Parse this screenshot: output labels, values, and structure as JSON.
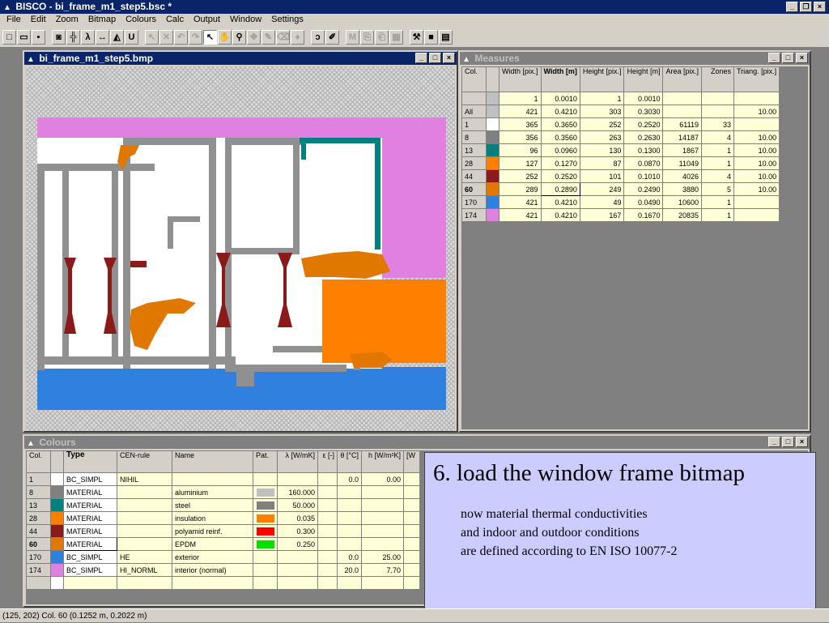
{
  "app": {
    "title": "BISCO - bi_frame_m1_step5.bsc *"
  },
  "menu": [
    "File",
    "Edit",
    "Zoom",
    "Bitmap",
    "Colours",
    "Calc",
    "Output",
    "Window",
    "Settings"
  ],
  "toolbar": {
    "zoom_label": "λ",
    "u_label": "U",
    "m_label": "M"
  },
  "bitmap_window": {
    "title": "bi_frame_m1_step5.bmp"
  },
  "measures_window": {
    "title": "Measures",
    "headers": [
      "Col.",
      "",
      "Width [pix.]",
      "Width [m]",
      "Height [pix.]",
      "Height [m]",
      "Area [pix.]",
      "Zones",
      "Triang. [pix.]"
    ],
    "rows": [
      {
        "col": "",
        "color": "#c0c0c0",
        "w_pix": "1",
        "w_m": "0.0010",
        "h_pix": "1",
        "h_m": "0.0010",
        "area": "",
        "zones": "",
        "triang": ""
      },
      {
        "col": "All",
        "color": "#c0c0c0",
        "w_pix": "421",
        "w_m": "0.4210",
        "h_pix": "303",
        "h_m": "0.3030",
        "area": "",
        "zones": "",
        "triang": "10.00"
      },
      {
        "col": "1",
        "color": "#ffffff",
        "w_pix": "365",
        "w_m": "0.3650",
        "h_pix": "252",
        "h_m": "0.2520",
        "area": "61119",
        "zones": "33",
        "triang": ""
      },
      {
        "col": "8",
        "color": "#808080",
        "w_pix": "356",
        "w_m": "0.3560",
        "h_pix": "263",
        "h_m": "0.2630",
        "area": "14187",
        "zones": "4",
        "triang": "10.00"
      },
      {
        "col": "13",
        "color": "#008080",
        "w_pix": "96",
        "w_m": "0.0960",
        "h_pix": "130",
        "h_m": "0.1300",
        "area": "1867",
        "zones": "1",
        "triang": "10.00"
      },
      {
        "col": "28",
        "color": "#ff8000",
        "w_pix": "127",
        "w_m": "0.1270",
        "h_pix": "87",
        "h_m": "0.0870",
        "area": "11049",
        "zones": "1",
        "triang": "10.00"
      },
      {
        "col": "44",
        "color": "#8b1a1a",
        "w_pix": "252",
        "w_m": "0.2520",
        "h_pix": "101",
        "h_m": "0.1010",
        "area": "4026",
        "zones": "4",
        "triang": "10.00"
      },
      {
        "col": "60",
        "color": "#e07800",
        "w_pix": "289",
        "w_m": "0.2890",
        "h_pix": "249",
        "h_m": "0.2490",
        "area": "3880",
        "zones": "5",
        "triang": "10.00"
      },
      {
        "col": "170",
        "color": "#3080e0",
        "w_pix": "421",
        "w_m": "0.4210",
        "h_pix": "49",
        "h_m": "0.0490",
        "area": "10600",
        "zones": "1",
        "triang": ""
      },
      {
        "col": "174",
        "color": "#e080e0",
        "w_pix": "421",
        "w_m": "0.4210",
        "h_pix": "167",
        "h_m": "0.1670",
        "area": "20835",
        "zones": "1",
        "triang": ""
      }
    ]
  },
  "colours_window": {
    "title": "Colours",
    "headers": [
      "Col.",
      "",
      "Type",
      "CEN-rule",
      "Name",
      "Pat.",
      "λ [W/mK]",
      "ε [-]",
      "θ [°C]",
      "h [W/m²K]",
      "[W"
    ],
    "rows": [
      {
        "col": "1",
        "color": "#ffffff",
        "type": "BC_SIMPL",
        "cen": "NIHIL",
        "name": "",
        "pat": "",
        "lambda": "",
        "eps": "",
        "theta": "0.0",
        "h": "0.00"
      },
      {
        "col": "8",
        "color": "#808080",
        "type": "MATERIAL",
        "cen": "",
        "name": "aluminium",
        "pat": "#c0c0c0",
        "lambda": "160.000",
        "eps": "",
        "theta": "",
        "h": ""
      },
      {
        "col": "13",
        "color": "#008080",
        "type": "MATERIAL",
        "cen": "",
        "name": "steel",
        "pat": "#808080",
        "lambda": "50.000",
        "eps": "",
        "theta": "",
        "h": ""
      },
      {
        "col": "28",
        "color": "#ff8000",
        "type": "MATERIAL",
        "cen": "",
        "name": "insulation",
        "pat": "#ff8000",
        "lambda": "0.035",
        "eps": "",
        "theta": "",
        "h": ""
      },
      {
        "col": "44",
        "color": "#8b1a1a",
        "type": "MATERIAL",
        "cen": "",
        "name": "polyamid reinf.",
        "pat": "#ff0000",
        "lambda": "0.300",
        "eps": "",
        "theta": "",
        "h": ""
      },
      {
        "col": "60",
        "color": "#e07800",
        "type": "MATERIAL",
        "cen": "",
        "name": "EPDM",
        "pat": "#00e000",
        "lambda": "0.250",
        "eps": "",
        "theta": "",
        "h": ""
      },
      {
        "col": "170",
        "color": "#3080e0",
        "type": "BC_SIMPL",
        "cen": "HE",
        "name": "exterior",
        "pat": "",
        "lambda": "",
        "eps": "",
        "theta": "0.0",
        "h": "25.00"
      },
      {
        "col": "174",
        "color": "#e080e0",
        "type": "BC_SIMPL",
        "cen": "HI_NORML",
        "name": "interior (normal)",
        "pat": "",
        "lambda": "",
        "eps": "",
        "theta": "20.0",
        "h": "7.70"
      }
    ]
  },
  "status": {
    "text": "(125, 202) Col. 60  (0.1252 m, 0.2022 m)"
  },
  "slide": {
    "heading": "6. load the window frame bitmap",
    "lines": [
      "now material thermal conductivities",
      "and indoor and outdoor conditions",
      "are defined according to EN ISO 10077-2"
    ]
  },
  "colors": {
    "interior": "#e080e0",
    "exterior": "#3080e0",
    "aluminium": "#909090",
    "steel": "#008080",
    "insulation": "#ff8000",
    "polyamid": "#8b1a1a",
    "epdm": "#e07800"
  }
}
